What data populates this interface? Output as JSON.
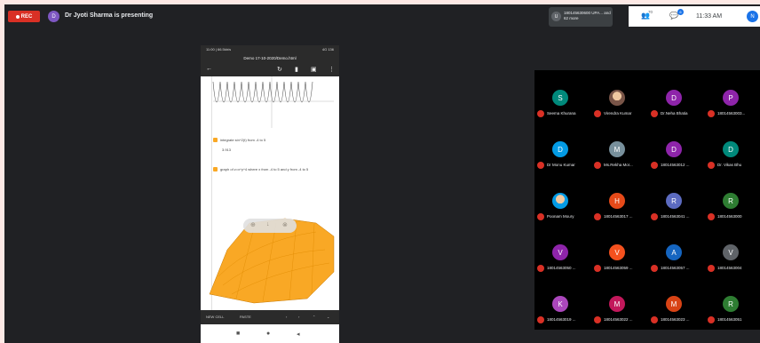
{
  "topbar": {
    "rec_label": "REC",
    "presenter_initial": "D",
    "presenting_text": "Dr Jyoti Sharma is presenting"
  },
  "small_tile": {
    "initial": "U",
    "name": "180145630600 UPA... and 62 more"
  },
  "top_right": {
    "people_count": "70",
    "chat_badge": "6",
    "time": "11:33 AM",
    "user_initial": "N"
  },
  "phone": {
    "status_left": "11:00 | 66.5kb/s",
    "status_right": "4G 136",
    "url": "Demo 17-10-2020/Demo.html",
    "cell1_text": "integrate sin^2(t) from -4 to 5",
    "cell1_result": "3.913",
    "cell2_text": "graph of z=x^y^4 where x from -4 to 5 and y from -4 to 5",
    "bottom_new": "NEW CELL",
    "bottom_paste": "PASTE"
  },
  "participants": [
    {
      "initial": "S",
      "name": "Seema Khurana",
      "color": "#00897b"
    },
    {
      "initial": "",
      "name": "Virendra Kumar",
      "color": "#795548",
      "photo": true
    },
    {
      "initial": "D",
      "name": "Dr.Neha Bhatia",
      "color": "#8e24aa"
    },
    {
      "initial": "P",
      "name": "18014563003...",
      "color": "#8e24aa"
    },
    {
      "initial": "D",
      "name": "Dr Monu Kumar",
      "color": "#039be5"
    },
    {
      "initial": "M",
      "name": "Ms.Rekha Mor...",
      "color": "#78909c"
    },
    {
      "initial": "D",
      "name": "18014563012 ...",
      "color": "#8e24aa"
    },
    {
      "initial": "D",
      "name": "Dr. Vikas Bhu",
      "color": "#00897b"
    },
    {
      "initial": "",
      "name": "Poonam Moury",
      "color": "#039be5",
      "photo": true
    },
    {
      "initial": "H",
      "name": "18014563017 ...",
      "color": "#e64a19"
    },
    {
      "initial": "R",
      "name": "18014563041 ...",
      "color": "#5c6bc0"
    },
    {
      "initial": "R",
      "name": "18014563000",
      "color": "#2e7d32"
    },
    {
      "initial": "V",
      "name": "18014563050 ...",
      "color": "#8e24aa"
    },
    {
      "initial": "V",
      "name": "18014563059 ...",
      "color": "#f4511e"
    },
    {
      "initial": "A",
      "name": "18014563057 ...",
      "color": "#1565c0"
    },
    {
      "initial": "V",
      "name": "18014563004",
      "color": "#5f6368"
    },
    {
      "initial": "K",
      "name": "18014563019 ...",
      "color": "#ab47bc"
    },
    {
      "initial": "M",
      "name": "18014563022 ...",
      "color": "#c2185b"
    },
    {
      "initial": "M",
      "name": "18014563023 ...",
      "color": "#d84315"
    },
    {
      "initial": "R",
      "name": "18014563051",
      "color": "#2e7d32"
    }
  ]
}
